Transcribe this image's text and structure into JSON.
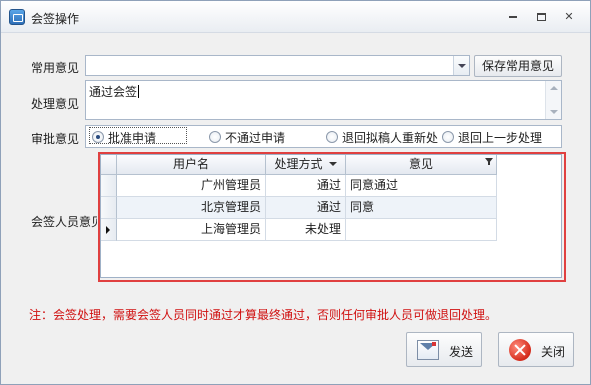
{
  "window": {
    "title": "会签操作"
  },
  "form": {
    "common_opinion_label": "常用意见",
    "common_opinion_value": "",
    "save_common_label": "保存常用意见",
    "process_opinion_label": "处理意见",
    "process_opinion_value": "通过会签",
    "approval_label": "审批意见",
    "approval_options": [
      "批准申请",
      "不通过申请",
      "退回拟稿人重新处理",
      "退回上一步处理"
    ],
    "approval_options_visible": [
      "批准申请",
      "不通过申请",
      "退回拟稿人重新处",
      "退回上一步处理"
    ],
    "approval_selected": "批准申请",
    "signers_label": "会签人员意见"
  },
  "grid": {
    "columns": [
      "用户名",
      "处理方式",
      "意见"
    ],
    "rows": [
      {
        "user": "广州管理员",
        "method": "通过",
        "opinion": "同意通过"
      },
      {
        "user": "北京管理员",
        "method": "通过",
        "opinion": "同意"
      },
      {
        "user": "上海管理员",
        "method": "未处理",
        "opinion": ""
      }
    ],
    "current_row": 3
  },
  "note": "注：会签处理，需要会签人员同时通过才算最终通过，否则任何审批人员可做退回处理。",
  "actions": {
    "send_label": "发送",
    "close_label": "关闭"
  },
  "colors": {
    "highlight_border": "#e04040",
    "note_text": "#d01010"
  }
}
